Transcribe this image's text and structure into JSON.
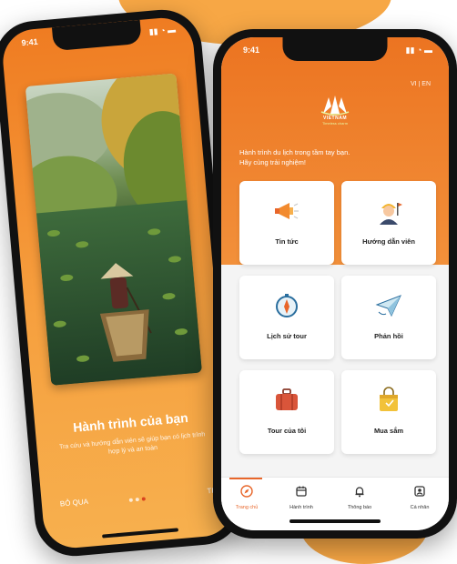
{
  "back_phone": {
    "status_time": "9:41",
    "title": "Hành trình của bạn",
    "subtitle": "Tra cứu và hướng dẫn viên sẽ giúp bạn có lịch trình hợp lý và an toàn",
    "skip_label": "BỎ QUA",
    "next_label": "TIẾP",
    "pagination": {
      "count": 3,
      "active_index": 2
    }
  },
  "front_phone": {
    "status_time": "9:41",
    "language": "VI | EN",
    "logo": {
      "text": "VIETNAM",
      "tagline": "Timeless charm"
    },
    "intro": "Hành trình du lịch trong tầm tay bạn.\nHãy cùng trải nghiệm!",
    "tiles": [
      {
        "label": "Tin tức",
        "icon": "megaphone-icon"
      },
      {
        "label": "Hướng dẫn viên",
        "icon": "tour-guide-icon"
      },
      {
        "label": "Lịch sử tour",
        "icon": "compass-icon"
      },
      {
        "label": "Phản hồi",
        "icon": "paper-plane-icon"
      },
      {
        "label": "Tour của tôi",
        "icon": "suitcase-icon"
      },
      {
        "label": "Mua sắm",
        "icon": "shopping-bag-icon"
      }
    ],
    "tabs": [
      {
        "label": "Trang chủ",
        "icon": "compass-tab-icon",
        "active": true
      },
      {
        "label": "Hành trình",
        "icon": "calendar-icon",
        "active": false
      },
      {
        "label": "Thông báo",
        "icon": "bell-icon",
        "active": false
      },
      {
        "label": "Cá nhân",
        "icon": "profile-icon",
        "active": false
      }
    ]
  },
  "colors": {
    "brand_orange": "#ec7421",
    "active_tab": "#e8662a",
    "tile_background": "#ffffff"
  }
}
